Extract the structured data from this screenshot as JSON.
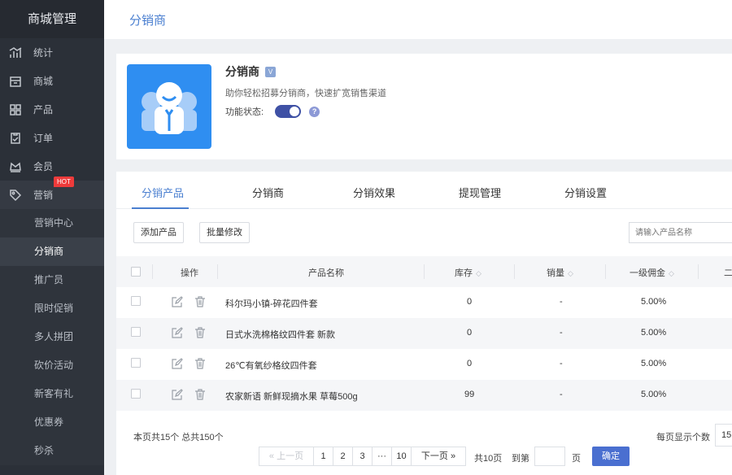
{
  "sidebar": {
    "brand": "商城管理",
    "items": [
      {
        "label": "统计",
        "icon": "chart-icon"
      },
      {
        "label": "商城",
        "icon": "shop-icon"
      },
      {
        "label": "产品",
        "icon": "grid-icon"
      },
      {
        "label": "订单",
        "icon": "clipboard-icon"
      },
      {
        "label": "会员",
        "icon": "crown-icon"
      },
      {
        "label": "营销",
        "icon": "tag-icon",
        "badge": "HOT"
      }
    ],
    "submenu": [
      "营销中心",
      "分销商",
      "推广员",
      "限时促销",
      "多人拼团",
      "砍价活动",
      "新客有礼",
      "优惠券",
      "秒杀"
    ],
    "active_sub": "分销商"
  },
  "header": {
    "title": "分销商"
  },
  "plugin": {
    "title": "分销商",
    "vip_badge": "V",
    "desc": "助你轻松招募分销商，快速扩宽销售渠道",
    "status_label": "功能状态:",
    "enabled": true,
    "help": "?"
  },
  "tabs": [
    "分销产品",
    "分销商",
    "分销效果",
    "提现管理",
    "分销设置"
  ],
  "toolbar": {
    "add_label": "添加产品",
    "batch_label": "批量修改",
    "search_placeholder": "请输入产品名称"
  },
  "table": {
    "headers": {
      "actions": "操作",
      "name": "产品名称",
      "stock": "库存",
      "sales": "销量",
      "commission1": "一级佣金",
      "commission2": "二"
    },
    "rows": [
      {
        "name": "科尔玛小镇-碎花四件套",
        "stock": "0",
        "sales": "-",
        "commission": "5.00%"
      },
      {
        "name": "日式水洗棉格纹四件套 新款",
        "stock": "0",
        "sales": "-",
        "commission": "5.00%"
      },
      {
        "name": "26℃有氧纱格纹四件套",
        "stock": "0",
        "sales": "-",
        "commission": "5.00%"
      },
      {
        "name": "农家新语 新鲜现摘水果 草莓500g",
        "stock": "99",
        "sales": "-",
        "commission": "5.00%"
      }
    ]
  },
  "footer": {
    "summary": "本页共15个  总共150个",
    "prev": "«  上一页",
    "pages": [
      "1",
      "2",
      "3",
      "···",
      "10"
    ],
    "next": "下一页  »",
    "total_pages": "共10页",
    "goto_label": "到第",
    "page_unit": "页",
    "confirm": "确定",
    "per_page_label": "每页显示个数",
    "per_page_value": "15"
  },
  "colors": {
    "sidebar_bg": "#2b3038",
    "accent": "#4a7fd0",
    "plugin_bg": "#2f8ef1",
    "hot": "#ee3b3b"
  }
}
